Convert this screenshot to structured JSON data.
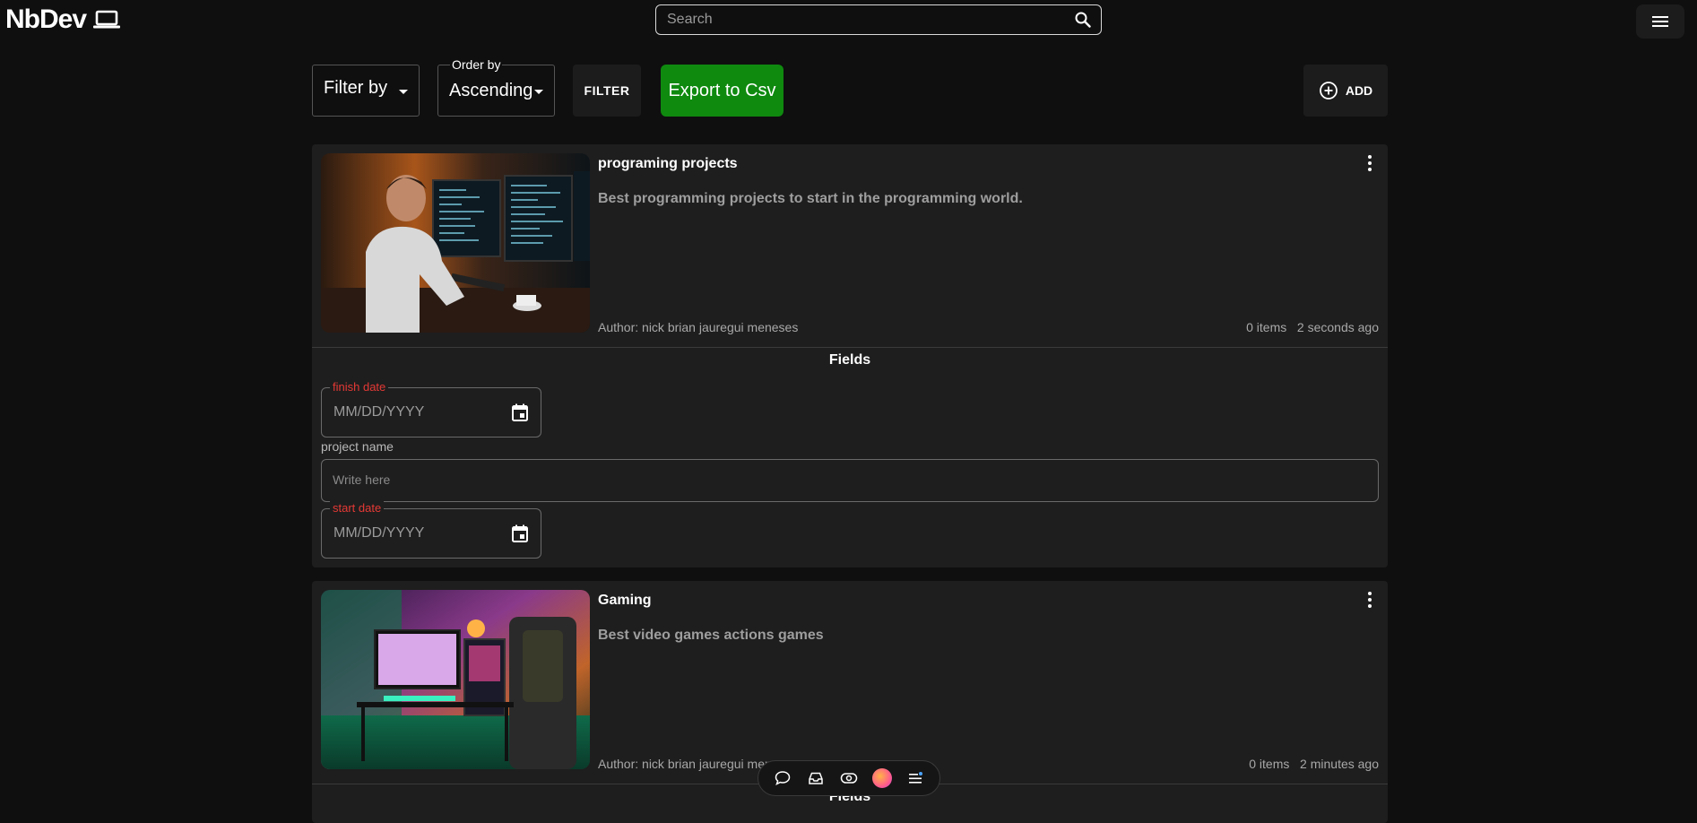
{
  "header": {
    "brand": "NbDev",
    "brand_icon": "laptop-icon",
    "search_placeholder": "Search"
  },
  "toolbar": {
    "filter_by_label": "Filter by",
    "order_by_legend": "Order by",
    "order_by_value": "Ascending",
    "filter_button": "FILTER",
    "export_button": "Export to Csv",
    "add_button": "ADD",
    "export_color": "#0f8a0f"
  },
  "cards": [
    {
      "title": "programing projects",
      "description": "Best programming projects to start in the programming world.",
      "author": "Author: nick brian jauregui meneses",
      "items": "0 items",
      "time": "2 seconds ago",
      "fields_title": "Fields",
      "fields": {
        "finish_date_label": "finish date",
        "finish_date_value": "MM/DD/YYYY",
        "project_name_label": "project name",
        "project_name_placeholder": "Write here",
        "start_date_label": "start date",
        "start_date_value": "MM/DD/YYYY"
      }
    },
    {
      "title": "Gaming",
      "description": "Best video games actions games",
      "author": "Author: nick brian jauregui meneses",
      "items": "0 items",
      "time": "2 minutes ago",
      "fields_title": "Fields"
    }
  ],
  "dock": {
    "items": [
      "chat-icon",
      "inbox-icon",
      "eye-icon",
      "avatar-orb",
      "list-icon"
    ]
  }
}
